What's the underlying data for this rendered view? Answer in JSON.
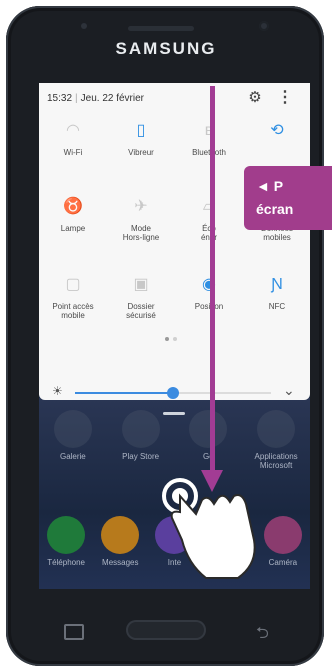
{
  "device": {
    "brand": "SAMSUNG"
  },
  "status_bar": {
    "time": "15:32",
    "date": "Jeu. 22 février"
  },
  "quick_settings": {
    "tiles": [
      {
        "label": "Wi-Fi",
        "icon": "wifi-icon",
        "active": false
      },
      {
        "label": "Vibreur",
        "icon": "vibrate-icon",
        "active": true
      },
      {
        "label": "Bluetooth",
        "icon": "bluetooth-icon",
        "active": false
      },
      {
        "label": "",
        "icon": "sync-icon",
        "active": true
      },
      {
        "label": "Lampe",
        "icon": "flashlight-icon",
        "active": false
      },
      {
        "label": "Mode\nHors-ligne",
        "icon": "airplane-icon",
        "active": false
      },
      {
        "label": "Éco\néner",
        "icon": "power-saving-icon",
        "active": false
      },
      {
        "label": "Données\nmobiles",
        "icon": "mobile-data-icon",
        "active": false
      },
      {
        "label": "Point accès\nmobile",
        "icon": "hotspot-icon",
        "active": false
      },
      {
        "label": "Dossier\nsécurisé",
        "icon": "secure-folder-icon",
        "active": false
      },
      {
        "label": "Position",
        "icon": "location-icon",
        "active": true
      },
      {
        "label": "NFC",
        "icon": "nfc-icon",
        "active": true
      }
    ],
    "page_indicator": {
      "current": 1,
      "total": 2
    },
    "brightness": {
      "level": 0.5
    }
  },
  "home_screen": {
    "row1": [
      "Galerie",
      "Play Store",
      "Go",
      "Applications\nMicrosoft"
    ],
    "row2": [
      "Téléphone",
      "Messages",
      "Inte",
      "",
      "Caméra"
    ]
  },
  "callout": {
    "line1": "◄ P",
    "line2": "écran"
  },
  "colors": {
    "accent": "#a23c94",
    "tile_active": "#2f8fe2",
    "panel_bg": "#f7f7f7"
  }
}
